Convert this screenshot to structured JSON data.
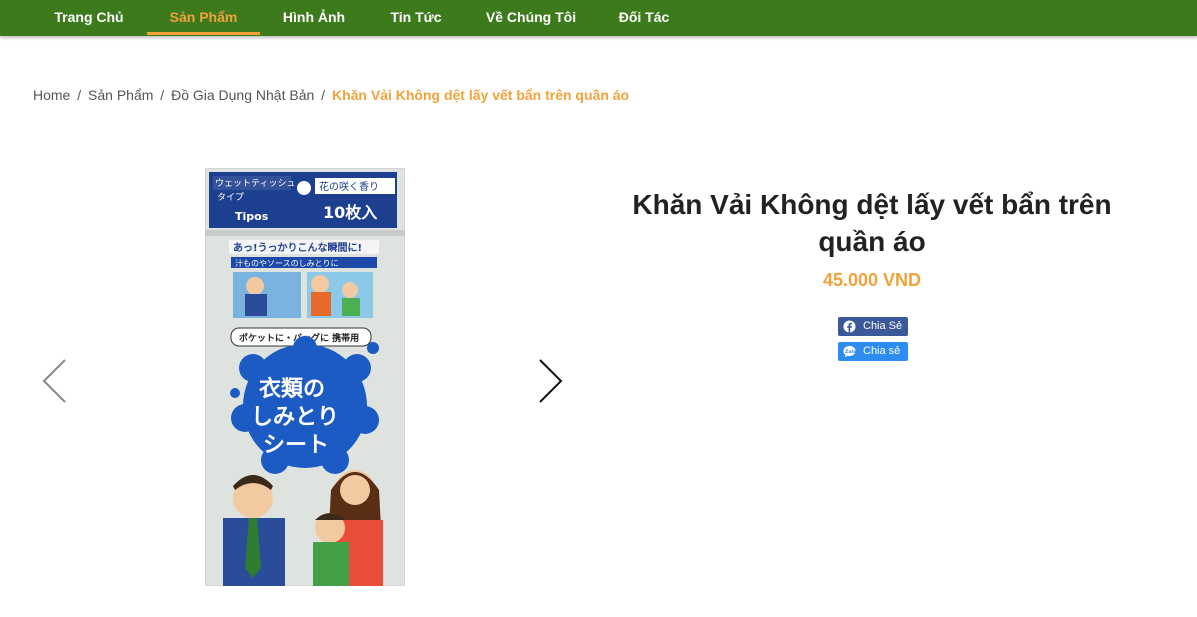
{
  "nav": {
    "items": [
      {
        "label": "Trang Chủ"
      },
      {
        "label": "Sản Phẩm"
      },
      {
        "label": "Hình Ảnh"
      },
      {
        "label": "Tin Tức"
      },
      {
        "label": "Về Chúng Tôi"
      },
      {
        "label": "Đối Tác"
      }
    ],
    "active_index": 1
  },
  "breadcrumb": {
    "home": "Home",
    "category": "Sản Phẩm",
    "subcategory": "Đồ Gia Dụng Nhật Bản",
    "separator": "/",
    "current": "Khăn Vải Không dệt lấy vết bẩn trên quần áo"
  },
  "product": {
    "title": "Khăn Vải Không dệt lấy vết bẩn trên quần áo",
    "price": "45.000 VND",
    "package_text": {
      "type_line1": "ウェットティッシュ",
      "type_line2": "タイプ",
      "scent": "花の咲く香り",
      "count": "10枚入",
      "tagline": "あっ!うっかりこんな瞬間に!",
      "subline": "汁ものやソースのしみとりに",
      "pocket": "ポケットに・バッグに 携帯用",
      "main_1": "衣類の",
      "main_2": "しみとり",
      "main_3": "シート",
      "brand": "Tipos"
    }
  },
  "share": {
    "facebook_label": "Chia Sẻ",
    "zalo_label": "Chia sẻ"
  },
  "carousel": {
    "prev_icon": "chevron-left-icon",
    "next_icon": "chevron-right-icon"
  },
  "colors": {
    "nav_bg": "#3d7a1c",
    "accent": "#f3a23a",
    "facebook": "#3b5998",
    "zalo": "#2d8cf0"
  }
}
